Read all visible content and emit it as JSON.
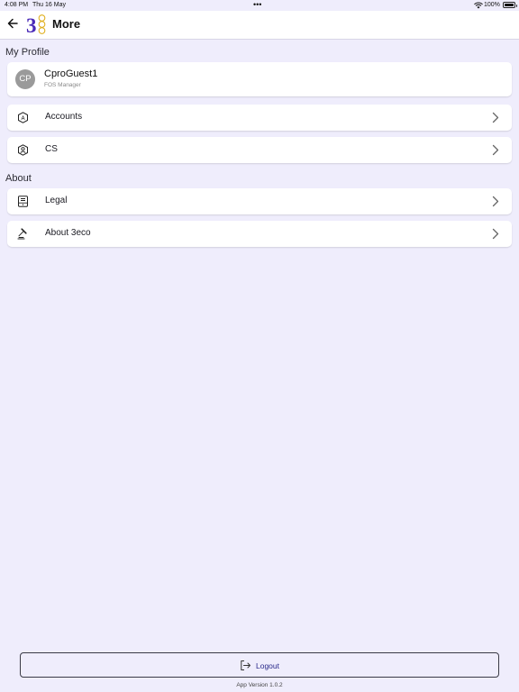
{
  "status_bar": {
    "time": "4:08 PM",
    "date": "Thu 16 May",
    "dots": "•••",
    "battery_text": "100%"
  },
  "header": {
    "title": "More",
    "back_icon": "arrow-left-icon",
    "logo_icon": "3eco-logo"
  },
  "profile_section": {
    "title": "My Profile",
    "avatar_initials": "CP",
    "name": "CproGuest1",
    "role": "FOS Manager"
  },
  "menu": [
    {
      "label": "Accounts",
      "icon": "account-shield-icon"
    },
    {
      "label": "CS",
      "icon": "person-shield-icon"
    }
  ],
  "about_section": {
    "title": "About",
    "items": [
      {
        "label": "Legal",
        "icon": "document-icon"
      },
      {
        "label": "About 3eco",
        "icon": "gavel-icon"
      }
    ]
  },
  "footer": {
    "logout_label": "Logout",
    "app_version": "App Version 1.0.2"
  },
  "colors": {
    "background": "#efedfc",
    "card": "#ffffff",
    "logo_purple": "#4b2bb8",
    "logo_gold": "#e0b020",
    "logout_text": "#2a2a8a"
  }
}
